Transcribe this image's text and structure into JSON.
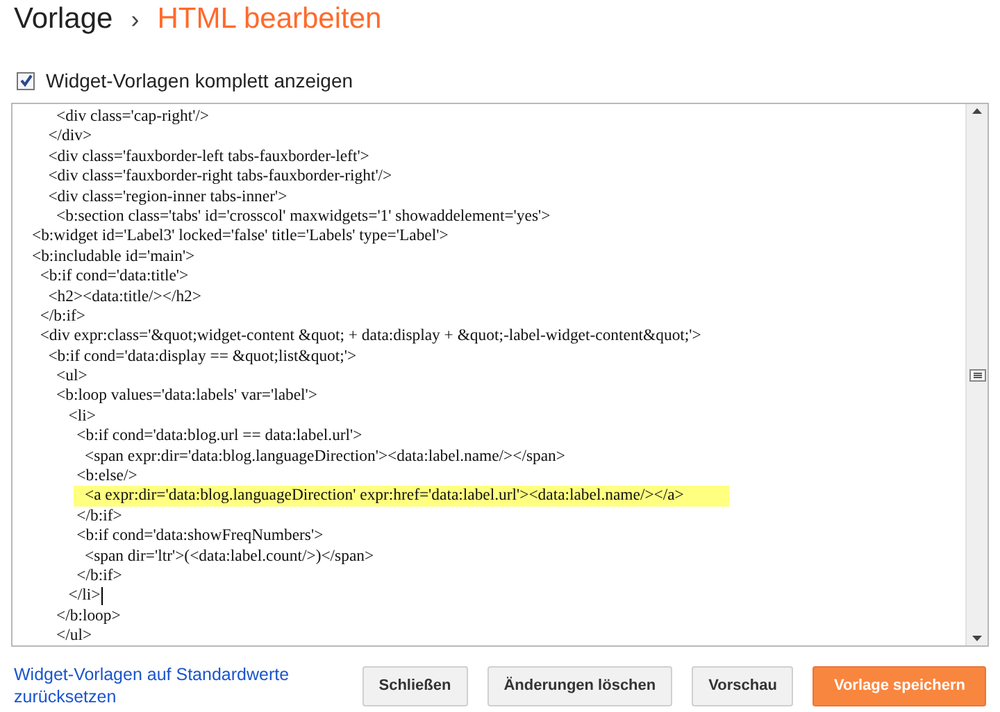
{
  "breadcrumb": [
    {
      "label": "Vorlage",
      "current": false
    },
    {
      "label": "›",
      "kind": "separator"
    },
    {
      "label": "HTML bearbeiten",
      "current": true
    }
  ],
  "option": {
    "label": "Widget-Vorlagen komplett anzeigen",
    "checked": true
  },
  "editor": {
    "lines": [
      {
        "text": "      <div class='cap-right'/>",
        "highlighted": false,
        "cursor": false
      },
      {
        "text": "    </div>",
        "highlighted": false,
        "cursor": false
      },
      {
        "text": "    <div class='fauxborder-left tabs-fauxborder-left'>",
        "highlighted": false,
        "cursor": false
      },
      {
        "text": "    <div class='fauxborder-right tabs-fauxborder-right'/>",
        "highlighted": false,
        "cursor": false
      },
      {
        "text": "    <div class='region-inner tabs-inner'>",
        "highlighted": false,
        "cursor": false
      },
      {
        "text": "      <b:section class='tabs' id='crosscol' maxwidgets='1' showaddelement='yes'>",
        "highlighted": false,
        "cursor": false
      },
      {
        "text": "<b:widget id='Label3' locked='false' title='Labels' type='Label'>",
        "highlighted": false,
        "cursor": false
      },
      {
        "text": "<b:includable id='main'>",
        "highlighted": false,
        "cursor": false
      },
      {
        "text": "  <b:if cond='data:title'>",
        "highlighted": false,
        "cursor": false
      },
      {
        "text": "    <h2><data:title/></h2>",
        "highlighted": false,
        "cursor": false
      },
      {
        "text": "  </b:if>",
        "highlighted": false,
        "cursor": false
      },
      {
        "text": "  <div expr:class='&quot;widget-content &quot; + data:display + &quot;-label-widget-content&quot;'>",
        "highlighted": false,
        "cursor": false
      },
      {
        "text": "    <b:if cond='data:display == &quot;list&quot;'>",
        "highlighted": false,
        "cursor": false
      },
      {
        "text": "      <ul>",
        "highlighted": false,
        "cursor": false
      },
      {
        "text": "      <b:loop values='data:labels' var='label'>",
        "highlighted": false,
        "cursor": false
      },
      {
        "text": "         <li>",
        "highlighted": false,
        "cursor": false
      },
      {
        "text": "           <b:if cond='data:blog.url == data:label.url'>",
        "highlighted": false,
        "cursor": false
      },
      {
        "text": "             <span expr:dir='data:blog.languageDirection'><data:label.name/></span>",
        "highlighted": false,
        "cursor": false
      },
      {
        "text": "           <b:else/>",
        "highlighted": false,
        "cursor": false
      },
      {
        "text": "             <a expr:dir='data:blog.languageDirection' expr:href='data:label.url'><data:label.name/></a>",
        "highlighted": true,
        "cursor": false
      },
      {
        "text": "           </b:if>",
        "highlighted": false,
        "cursor": false
      },
      {
        "text": "           <b:if cond='data:showFreqNumbers'>",
        "highlighted": false,
        "cursor": false
      },
      {
        "text": "             <span dir='ltr'>(<data:label.count/>)</span>",
        "highlighted": false,
        "cursor": false
      },
      {
        "text": "           </b:if>",
        "highlighted": false,
        "cursor": false
      },
      {
        "text": "         </li>",
        "highlighted": false,
        "cursor": true
      },
      {
        "text": "      </b:loop>",
        "highlighted": false,
        "cursor": false
      },
      {
        "text": "      </ul>",
        "highlighted": false,
        "cursor": false
      }
    ]
  },
  "reset_link": "Widget-Vorlagen auf Standardwerte zurücksetzen",
  "buttons": [
    {
      "label": "Schließen",
      "kind": "default"
    },
    {
      "label": "Änderungen löschen",
      "kind": "default"
    },
    {
      "label": "Vorschau",
      "kind": "default"
    },
    {
      "label": "Vorlage speichern",
      "kind": "primary"
    }
  ]
}
